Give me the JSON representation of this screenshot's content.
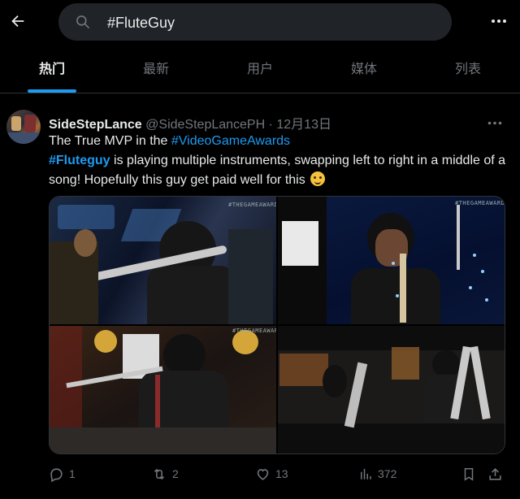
{
  "search": {
    "query": "#FluteGuy"
  },
  "tabs": [
    {
      "label": "热门",
      "active": true
    },
    {
      "label": "最新",
      "active": false
    },
    {
      "label": "用户",
      "active": false
    },
    {
      "label": "媒体",
      "active": false
    },
    {
      "label": "列表",
      "active": false
    }
  ],
  "post": {
    "display_name": "SideStepLance",
    "handle": "@SideStepLancePH",
    "separator": " · ",
    "date": "12月13日",
    "text": {
      "line1_prefix": "The True MVP in the ",
      "line1_tag": "#VideoGameAwards",
      "tag2": "#Fluteguy",
      "body": " is playing multiple instruments, swapping left to right in a middle of a song! Hopefully this guy get paid well for this "
    },
    "media_watermarks": [
      "#THEGAMEAWARDS",
      "#THEGAMEAWARDS",
      "#THEGAMEAWARDS"
    ],
    "stats": {
      "replies": "1",
      "reposts": "2",
      "likes": "13",
      "views": "372"
    }
  },
  "colors": {
    "accent": "#1d9bf0",
    "muted": "#71767b",
    "text": "#e7e9ea",
    "background": "#000000"
  }
}
